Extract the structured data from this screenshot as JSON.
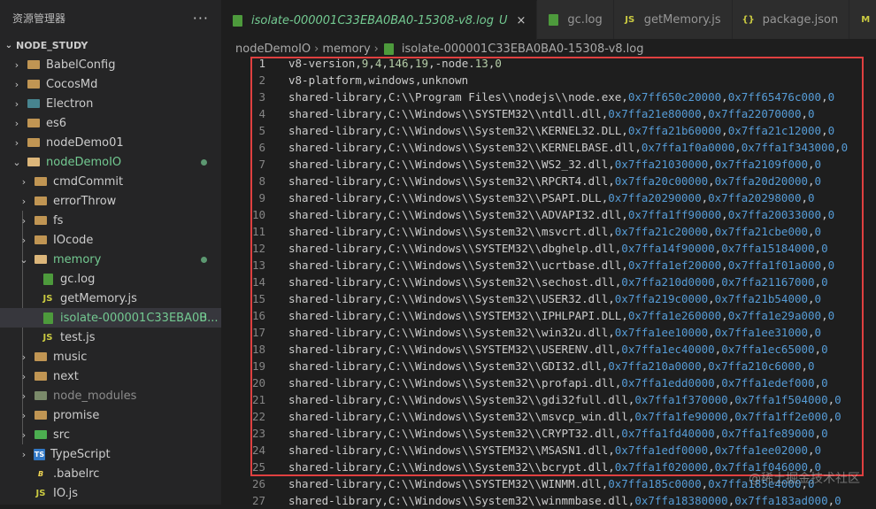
{
  "sidebar": {
    "title": "资源管理器",
    "more": "···",
    "section": "NODE_STUDY",
    "items": [
      {
        "label": "BabelConfig",
        "kind": "folder",
        "depth": 1,
        "chevron": "›"
      },
      {
        "label": "CocosMd",
        "kind": "folder",
        "depth": 1,
        "chevron": "›"
      },
      {
        "label": "Electron",
        "kind": "electron",
        "depth": 1,
        "chevron": "›"
      },
      {
        "label": "es6",
        "kind": "folder",
        "depth": 1,
        "chevron": "›"
      },
      {
        "label": "nodeDemo01",
        "kind": "folder",
        "depth": 1,
        "chevron": "›"
      },
      {
        "label": "nodeDemoIO",
        "kind": "folder-open",
        "depth": 1,
        "chevron": "⌄",
        "dot": true
      },
      {
        "label": "cmdCommit",
        "kind": "folder",
        "depth": 2,
        "chevron": "›"
      },
      {
        "label": "errorThrow",
        "kind": "folder",
        "depth": 2,
        "chevron": "›"
      },
      {
        "label": "fs",
        "kind": "folder",
        "depth": 2,
        "chevron": "›"
      },
      {
        "label": "IOcode",
        "kind": "folder",
        "depth": 2,
        "chevron": "›"
      },
      {
        "label": "memory",
        "kind": "folder-open",
        "depth": 2,
        "chevron": "⌄",
        "dot": true
      },
      {
        "label": "gc.log",
        "kind": "log",
        "depth": 3
      },
      {
        "label": "getMemory.js",
        "kind": "js",
        "depth": 3
      },
      {
        "label": "isolate-000001C33EBA0B...",
        "kind": "log",
        "depth": 3,
        "selected": true,
        "badge": "U"
      },
      {
        "label": "test.js",
        "kind": "js",
        "depth": 3
      },
      {
        "label": "music",
        "kind": "folder",
        "depth": 2,
        "chevron": "›"
      },
      {
        "label": "next",
        "kind": "folder",
        "depth": 2,
        "chevron": "›"
      },
      {
        "label": "node_modules",
        "kind": "node",
        "depth": 2,
        "chevron": "›",
        "muted": true
      },
      {
        "label": "promise",
        "kind": "folder",
        "depth": 2,
        "chevron": "›"
      },
      {
        "label": "src",
        "kind": "src",
        "depth": 2,
        "chevron": "›"
      },
      {
        "label": "TypeScript",
        "kind": "ts",
        "depth": 2,
        "chevron": "›"
      },
      {
        "label": ".babelrc",
        "kind": "babel",
        "depth": 2
      },
      {
        "label": "IO.js",
        "kind": "js",
        "depth": 2
      }
    ]
  },
  "tabs": [
    {
      "label": "isolate-000001C33EBA0BA0-15308-v8.log",
      "kind": "log",
      "active": true,
      "badge": "U",
      "close": "×"
    },
    {
      "label": "gc.log",
      "kind": "log"
    },
    {
      "label": "getMemory.js",
      "kind": "js"
    },
    {
      "label": "package.json",
      "kind": "json"
    },
    {
      "label": "",
      "kind": "md"
    }
  ],
  "breadcrumb": [
    "nodeDemoIO",
    "memory",
    "isolate-000001C33EBA0BA0-15308-v8.log"
  ],
  "breadcrumb_sep": "›",
  "code_lines": [
    "v8-version,9,4,146,19,-node.13,0",
    "v8-platform,windows,unknown",
    "shared-library,C:\\\\Program Files\\\\nodejs\\\\node.exe,0x7ff650c20000,0x7ff65476c000,0",
    "shared-library,C:\\\\Windows\\\\SYSTEM32\\\\ntdll.dll,0x7ffa21e80000,0x7ffa22070000,0",
    "shared-library,C:\\\\Windows\\\\System32\\\\KERNEL32.DLL,0x7ffa21b60000,0x7ffa21c12000,0",
    "shared-library,C:\\\\Windows\\\\System32\\\\KERNELBASE.dll,0x7ffa1f0a0000,0x7ffa1f343000,0",
    "shared-library,C:\\\\Windows\\\\System32\\\\WS2_32.dll,0x7ffa21030000,0x7ffa2109f000,0",
    "shared-library,C:\\\\Windows\\\\System32\\\\RPCRT4.dll,0x7ffa20c00000,0x7ffa20d20000,0",
    "shared-library,C:\\\\Windows\\\\System32\\\\PSAPI.DLL,0x7ffa20290000,0x7ffa20298000,0",
    "shared-library,C:\\\\Windows\\\\System32\\\\ADVAPI32.dll,0x7ffa1ff90000,0x7ffa20033000,0",
    "shared-library,C:\\\\Windows\\\\System32\\\\msvcrt.dll,0x7ffa21c20000,0x7ffa21cbe000,0",
    "shared-library,C:\\\\Windows\\\\SYSTEM32\\\\dbghelp.dll,0x7ffa14f90000,0x7ffa15184000,0",
    "shared-library,C:\\\\Windows\\\\System32\\\\ucrtbase.dll,0x7ffa1ef20000,0x7ffa1f01a000,0",
    "shared-library,C:\\\\Windows\\\\System32\\\\sechost.dll,0x7ffa210d0000,0x7ffa21167000,0",
    "shared-library,C:\\\\Windows\\\\System32\\\\USER32.dll,0x7ffa219c0000,0x7ffa21b54000,0",
    "shared-library,C:\\\\Windows\\\\SYSTEM32\\\\IPHLPAPI.DLL,0x7ffa1e260000,0x7ffa1e29a000,0",
    "shared-library,C:\\\\Windows\\\\System32\\\\win32u.dll,0x7ffa1ee10000,0x7ffa1ee31000,0",
    "shared-library,C:\\\\Windows\\\\SYSTEM32\\\\USERENV.dll,0x7ffa1ec40000,0x7ffa1ec65000,0",
    "shared-library,C:\\\\Windows\\\\System32\\\\GDI32.dll,0x7ffa210a0000,0x7ffa210c6000,0",
    "shared-library,C:\\\\Windows\\\\System32\\\\profapi.dll,0x7ffa1edd0000,0x7ffa1edef000,0",
    "shared-library,C:\\\\Windows\\\\System32\\\\gdi32full.dll,0x7ffa1f370000,0x7ffa1f504000,0",
    "shared-library,C:\\\\Windows\\\\System32\\\\msvcp_win.dll,0x7ffa1fe90000,0x7ffa1ff2e000,0",
    "shared-library,C:\\\\Windows\\\\System32\\\\CRYPT32.dll,0x7ffa1fd40000,0x7ffa1fe89000,0",
    "shared-library,C:\\\\Windows\\\\SYSTEM32\\\\MSASN1.dll,0x7ffa1edf0000,0x7ffa1ee02000,0",
    "shared-library,C:\\\\Windows\\\\System32\\\\bcrypt.dll,0x7ffa1f020000,0x7ffa1f046000,0",
    "shared-library,C:\\\\Windows\\\\SYSTEM32\\\\WINMM.dll,0x7ffa185c0000,0x7ffa185e4000,0",
    "shared-library,C:\\\\Windows\\\\System32\\\\winmmbase.dll,0x7ffa18380000,0x7ffa183ad000,0"
  ],
  "current_line": 1,
  "watermark": "@稀土掘金技术社区",
  "colors": {
    "accent_border": "#e04040",
    "git_untracked": "#73c991"
  }
}
